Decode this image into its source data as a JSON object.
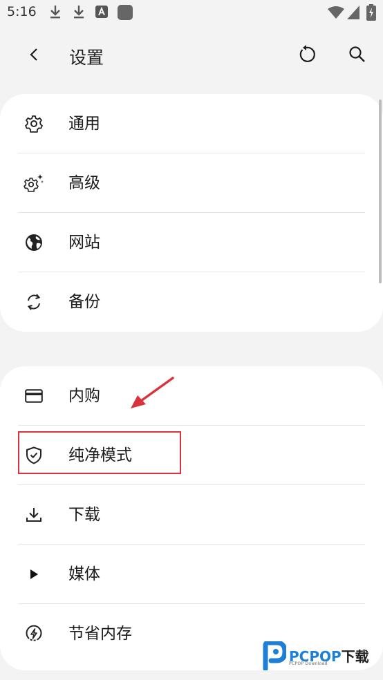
{
  "status_bar": {
    "time": "5:16",
    "icons": [
      "download-icon",
      "download-icon",
      "font-app-icon",
      "app-icon",
      "wifi-icon",
      "signal-icon",
      "battery-charging-icon"
    ]
  },
  "app_bar": {
    "title": "设置",
    "back_icon": "back-arrow-icon",
    "reset_icon": "reset-icon",
    "search_icon": "search-icon"
  },
  "group1": {
    "items": [
      {
        "label": "通用",
        "icon": "gear-icon"
      },
      {
        "label": "高级",
        "icon": "gear-sparkle-icon"
      },
      {
        "label": "网站",
        "icon": "globe-icon"
      },
      {
        "label": "备份",
        "icon": "sync-icon"
      }
    ]
  },
  "group2": {
    "items": [
      {
        "label": "内购",
        "icon": "credit-card-icon"
      },
      {
        "label": "纯净模式",
        "icon": "shield-check-icon"
      },
      {
        "label": "下载",
        "icon": "download-icon"
      },
      {
        "label": "媒体",
        "icon": "play-icon"
      },
      {
        "label": "节省内存",
        "icon": "memory-saver-icon"
      }
    ]
  },
  "watermark": {
    "text_a": "PCPOP",
    "text_b": "下载",
    "sub": "PCPOP Download"
  },
  "colors": {
    "background": "#f3f3f3",
    "card": "#ffffff",
    "annotation_red": "#d9343b",
    "watermark_blue": "#1e7fd6"
  }
}
